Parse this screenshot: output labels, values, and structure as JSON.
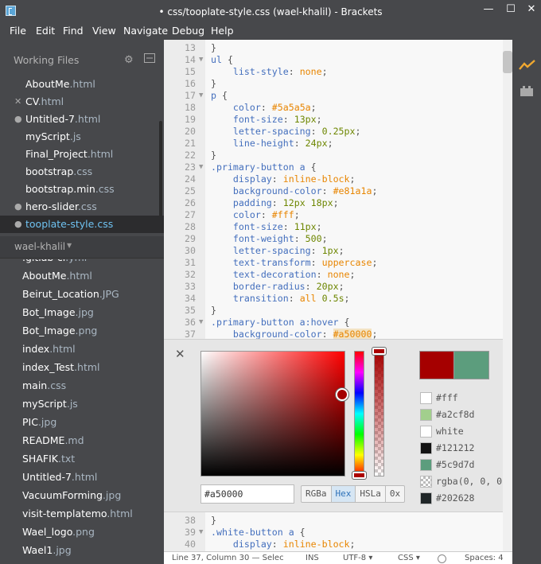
{
  "window": {
    "title": "• css/tooplate-style.css (wael-khalil) - Brackets",
    "minimize": "—",
    "maximize": "☐",
    "close": "✕"
  },
  "menu": [
    "File",
    "Edit",
    "Find",
    "View",
    "Navigate",
    "Debug",
    "Help"
  ],
  "working_files": {
    "heading": "Working Files",
    "items": [
      {
        "name": "AboutMe",
        "ext": ".html",
        "marker": ""
      },
      {
        "name": "CV",
        "ext": ".html",
        "marker": "✕"
      },
      {
        "name": "Untitled-7",
        "ext": ".html",
        "marker": "●"
      },
      {
        "name": "myScript",
        "ext": ".js",
        "marker": ""
      },
      {
        "name": "Final_Project",
        "ext": ".html",
        "marker": ""
      },
      {
        "name": "bootstrap",
        "ext": ".css",
        "marker": ""
      },
      {
        "name": "bootstrap.min",
        "ext": ".css",
        "marker": ""
      },
      {
        "name": "hero-slider",
        "ext": ".css",
        "marker": "●"
      },
      {
        "name": "tooplate-style",
        "ext": ".css",
        "marker": "●"
      }
    ]
  },
  "project": {
    "name": "wael-khalil",
    "files": [
      {
        "name": ".gitlab-ci",
        "ext": ".yml"
      },
      {
        "name": "AboutMe",
        "ext": ".html"
      },
      {
        "name": "Beirut_Location",
        "ext": ".JPG"
      },
      {
        "name": "Bot_Image",
        "ext": ".jpg"
      },
      {
        "name": "Bot_Image",
        "ext": ".png"
      },
      {
        "name": "index",
        "ext": ".html"
      },
      {
        "name": "index_Test",
        "ext": ".html"
      },
      {
        "name": "main",
        "ext": ".css"
      },
      {
        "name": "myScript",
        "ext": ".js"
      },
      {
        "name": "PIC",
        "ext": ".jpg"
      },
      {
        "name": "README",
        "ext": ".md"
      },
      {
        "name": "SHAFIK",
        "ext": ".txt"
      },
      {
        "name": "Untitled-7",
        "ext": ".html"
      },
      {
        "name": "VacuumForming",
        "ext": ".jpg"
      },
      {
        "name": "visit-templatemo",
        "ext": ".html"
      },
      {
        "name": "Wael_logo",
        "ext": ".png"
      },
      {
        "name": "Wael1",
        "ext": ".jpg"
      }
    ]
  },
  "editor": {
    "lines_top": [
      {
        "n": "13",
        "fold": "",
        "tokens": [
          [
            "}",
            "punc"
          ]
        ]
      },
      {
        "n": "14",
        "fold": "▼",
        "tokens": [
          [
            "ul",
            "sel"
          ],
          [
            " {",
            "punc"
          ]
        ]
      },
      {
        "n": "15",
        "fold": "",
        "tokens": [
          [
            "    list-style",
            "prop"
          ],
          [
            ": ",
            "punc"
          ],
          [
            "none",
            "val"
          ],
          [
            ";",
            "punc"
          ]
        ]
      },
      {
        "n": "16",
        "fold": "",
        "tokens": [
          [
            "}",
            "punc"
          ]
        ]
      },
      {
        "n": "17",
        "fold": "▼",
        "tokens": [
          [
            "p",
            "sel"
          ],
          [
            " {",
            "punc"
          ]
        ]
      },
      {
        "n": "18",
        "fold": "",
        "tokens": [
          [
            "    color",
            "prop"
          ],
          [
            ": ",
            "punc"
          ],
          [
            "#5a5a5a",
            "val"
          ],
          [
            ";",
            "punc"
          ]
        ]
      },
      {
        "n": "19",
        "fold": "",
        "tokens": [
          [
            "    font-size",
            "prop"
          ],
          [
            ": ",
            "punc"
          ],
          [
            "13px",
            "num"
          ],
          [
            ";",
            "punc"
          ]
        ]
      },
      {
        "n": "20",
        "fold": "",
        "tokens": [
          [
            "    letter-spacing",
            "prop"
          ],
          [
            ": ",
            "punc"
          ],
          [
            "0.25px",
            "num"
          ],
          [
            ";",
            "punc"
          ]
        ]
      },
      {
        "n": "21",
        "fold": "",
        "tokens": [
          [
            "    line-height",
            "prop"
          ],
          [
            ": ",
            "punc"
          ],
          [
            "24px",
            "num"
          ],
          [
            ";",
            "punc"
          ]
        ]
      },
      {
        "n": "22",
        "fold": "",
        "tokens": [
          [
            "}",
            "punc"
          ]
        ]
      },
      {
        "n": "23",
        "fold": "▼",
        "tokens": [
          [
            ".primary-button a",
            "sel"
          ],
          [
            " {",
            "punc"
          ]
        ]
      },
      {
        "n": "24",
        "fold": "",
        "tokens": [
          [
            "    display",
            "prop"
          ],
          [
            ": ",
            "punc"
          ],
          [
            "inline-block",
            "val"
          ],
          [
            ";",
            "punc"
          ]
        ]
      },
      {
        "n": "25",
        "fold": "",
        "tokens": [
          [
            "    background-color",
            "prop"
          ],
          [
            ": ",
            "punc"
          ],
          [
            "#e81a1a",
            "val"
          ],
          [
            ";",
            "punc"
          ]
        ]
      },
      {
        "n": "26",
        "fold": "",
        "tokens": [
          [
            "    padding",
            "prop"
          ],
          [
            ": ",
            "punc"
          ],
          [
            "12px 18px",
            "num"
          ],
          [
            ";",
            "punc"
          ]
        ]
      },
      {
        "n": "27",
        "fold": "",
        "tokens": [
          [
            "    color",
            "prop"
          ],
          [
            ": ",
            "punc"
          ],
          [
            "#fff",
            "val"
          ],
          [
            ";",
            "punc"
          ]
        ]
      },
      {
        "n": "28",
        "fold": "",
        "tokens": [
          [
            "    font-size",
            "prop"
          ],
          [
            ": ",
            "punc"
          ],
          [
            "11px",
            "num"
          ],
          [
            ";",
            "punc"
          ]
        ]
      },
      {
        "n": "29",
        "fold": "",
        "tokens": [
          [
            "    font-weight",
            "prop"
          ],
          [
            ": ",
            "punc"
          ],
          [
            "500",
            "num"
          ],
          [
            ";",
            "punc"
          ]
        ]
      },
      {
        "n": "30",
        "fold": "",
        "tokens": [
          [
            "    letter-spacing",
            "prop"
          ],
          [
            ": ",
            "punc"
          ],
          [
            "1px",
            "num"
          ],
          [
            ";",
            "punc"
          ]
        ]
      },
      {
        "n": "31",
        "fold": "",
        "tokens": [
          [
            "    text-transform",
            "prop"
          ],
          [
            ": ",
            "punc"
          ],
          [
            "uppercase",
            "val"
          ],
          [
            ";",
            "punc"
          ]
        ]
      },
      {
        "n": "32",
        "fold": "",
        "tokens": [
          [
            "    text-decoration",
            "prop"
          ],
          [
            ": ",
            "punc"
          ],
          [
            "none",
            "val"
          ],
          [
            ";",
            "punc"
          ]
        ]
      },
      {
        "n": "33",
        "fold": "",
        "tokens": [
          [
            "    border-radius",
            "prop"
          ],
          [
            ": ",
            "punc"
          ],
          [
            "20px",
            "num"
          ],
          [
            ";",
            "punc"
          ]
        ]
      },
      {
        "n": "34",
        "fold": "",
        "tokens": [
          [
            "    transition",
            "prop"
          ],
          [
            ": ",
            "punc"
          ],
          [
            "all ",
            "val"
          ],
          [
            "0.5s",
            "num"
          ],
          [
            ";",
            "punc"
          ]
        ]
      },
      {
        "n": "35",
        "fold": "",
        "tokens": [
          [
            "}",
            "punc"
          ]
        ]
      },
      {
        "n": "36",
        "fold": "▼",
        "tokens": [
          [
            ".primary-button a:hover",
            "sel"
          ],
          [
            " {",
            "punc"
          ]
        ]
      },
      {
        "n": "37",
        "fold": "",
        "tokens": [
          [
            "    background-color",
            "prop"
          ],
          [
            ": ",
            "punc"
          ],
          [
            "#a50000",
            "hl"
          ],
          [
            ";",
            "punc"
          ]
        ]
      }
    ],
    "lines_bottom": [
      {
        "n": "38",
        "fold": "",
        "tokens": [
          [
            "}",
            "punc"
          ]
        ]
      },
      {
        "n": "39",
        "fold": "▼",
        "tokens": [
          [
            ".white-button a",
            "sel"
          ],
          [
            " {",
            "punc"
          ]
        ]
      },
      {
        "n": "40",
        "fold": "",
        "tokens": [
          [
            "    display",
            "prop"
          ],
          [
            ": ",
            "punc"
          ],
          [
            "inline-block",
            "val"
          ],
          [
            ";",
            "punc"
          ]
        ]
      }
    ]
  },
  "color_picker": {
    "close": "✕",
    "hex_value": "#a50000",
    "current_color": "#a50000",
    "original_color": "#5c9d7d",
    "saturation": 0.98,
    "brightness": 0.65,
    "modes": [
      {
        "label": "RGBa",
        "active": false
      },
      {
        "label": "Hex",
        "active": true
      },
      {
        "label": "HSLa",
        "active": false
      },
      {
        "label": "0x",
        "active": false
      }
    ],
    "swatches": [
      {
        "label": "#fff",
        "color": "#ffffff"
      },
      {
        "label": "#a2cf8d",
        "color": "#a2cf8d"
      },
      {
        "label": "white",
        "color": "#ffffff"
      },
      {
        "label": "#121212",
        "color": "#121212"
      },
      {
        "label": "#5c9d7d",
        "color": "#5c9d7d"
      },
      {
        "label": "rgba(0, 0, 0",
        "color": "checker"
      },
      {
        "label": "#202628",
        "color": "#202628"
      }
    ]
  },
  "status": {
    "position": "Line 37, Column 30 — Selec",
    "mode": "INS",
    "encoding": "UTF-8 ▾",
    "language": "CSS ▾",
    "spaces": "Spaces: 4"
  }
}
